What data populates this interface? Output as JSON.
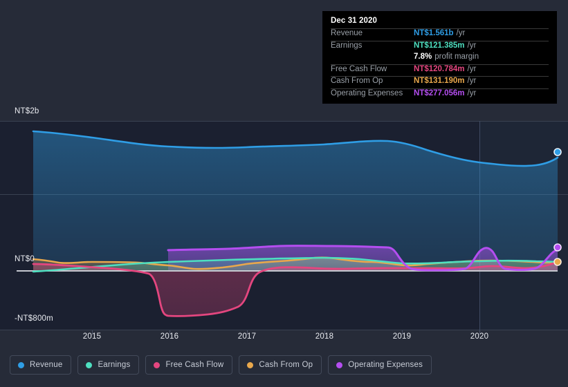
{
  "tooltip": {
    "date": "Dec 31 2020",
    "rows": [
      {
        "label": "Revenue",
        "value": "NT$1.561b",
        "unit": "/yr",
        "color": "#2f9ee6"
      },
      {
        "label": "Earnings",
        "value": "NT$121.385m",
        "unit": "/yr",
        "color": "#4edfc0"
      },
      {
        "label": "Free Cash Flow",
        "value": "NT$120.784m",
        "unit": "/yr",
        "color": "#e4467f"
      },
      {
        "label": "Cash From Op",
        "value": "NT$131.190m",
        "unit": "/yr",
        "color": "#e9a84c"
      },
      {
        "label": "Operating Expenses",
        "value": "NT$277.056m",
        "unit": "/yr",
        "color": "#b44ef0"
      }
    ],
    "margin_value": "7.8%",
    "margin_label": "profit margin"
  },
  "legend": [
    {
      "label": "Revenue",
      "color": "#2f9ee6"
    },
    {
      "label": "Earnings",
      "color": "#4edfc0"
    },
    {
      "label": "Free Cash Flow",
      "color": "#e4467f"
    },
    {
      "label": "Cash From Op",
      "color": "#e9a84c"
    },
    {
      "label": "Operating Expenses",
      "color": "#b44ef0"
    }
  ],
  "axis": {
    "y_top_label": "NT$2b",
    "y_zero_label": "NT$0",
    "y_bottom_label": "-NT$800m",
    "x_labels": [
      "2015",
      "2016",
      "2017",
      "2018",
      "2019",
      "2020"
    ]
  },
  "chart_data": {
    "type": "area",
    "title": "",
    "xlabel": "",
    "ylabel": "",
    "currency": "NT$",
    "ylim": [
      -800,
      2000
    ],
    "yunit": "millions",
    "yticks": [
      2000,
      0,
      -800
    ],
    "ytick_labels": [
      "NT$2b",
      "NT$0",
      "-NT$800m"
    ],
    "xlim": [
      "2014.5",
      "2020.9"
    ],
    "xticks": [
      "2015",
      "2016",
      "2017",
      "2018",
      "2019",
      "2020"
    ],
    "grid": true,
    "legend_position": "bottom",
    "forecast_band_start": "2020",
    "x": [
      2014.55,
      2014.8,
      2015.0,
      2015.25,
      2015.5,
      2015.75,
      2016.0,
      2016.25,
      2016.5,
      2016.75,
      2017.0,
      2017.25,
      2017.5,
      2017.75,
      2018.0,
      2018.25,
      2018.5,
      2018.75,
      2019.0,
      2019.25,
      2019.5,
      2019.75,
      2020.0,
      2020.25,
      2020.5,
      2020.75,
      2020.9
    ],
    "series": [
      {
        "name": "Revenue",
        "color": "#2f9ee6",
        "values": [
          1880,
          1862,
          1845,
          1820,
          1800,
          1790,
          1785,
          1780,
          1775,
          1778,
          1782,
          1775,
          1770,
          1778,
          1790,
          1800,
          1790,
          1760,
          1700,
          1660,
          1640,
          1620,
          1600,
          1570,
          1548,
          1550,
          1561
        ]
      },
      {
        "name": "Earnings",
        "color": "#4edfc0",
        "values": [
          -10,
          0,
          10,
          25,
          40,
          55,
          68,
          78,
          85,
          92,
          96,
          100,
          104,
          108,
          112,
          115,
          116,
          112,
          104,
          100,
          104,
          110,
          114,
          116,
          118,
          120,
          121
        ]
      },
      {
        "name": "Free Cash Flow",
        "color": "#e4467f",
        "values": [
          95,
          92,
          88,
          80,
          72,
          60,
          20,
          -480,
          -660,
          -670,
          -660,
          -640,
          -600,
          -540,
          -430,
          -220,
          -30,
          40,
          60,
          55,
          40,
          50,
          80,
          95,
          45,
          95,
          121
        ]
      },
      {
        "name": "Cash From Op",
        "color": "#e9a84c",
        "values": [
          160,
          150,
          134,
          120,
          118,
          126,
          128,
          120,
          96,
          80,
          76,
          82,
          96,
          110,
          122,
          160,
          185,
          176,
          140,
          118,
          110,
          118,
          130,
          140,
          142,
          138,
          131
        ]
      },
      {
        "name": "Operating Expenses",
        "color": "#b44ef0",
        "values": [
          null,
          null,
          null,
          null,
          null,
          null,
          280,
          282,
          280,
          284,
          292,
          296,
          290,
          288,
          292,
          294,
          290,
          288,
          30,
          22,
          18,
          20,
          160,
          22,
          18,
          120,
          277
        ]
      }
    ]
  }
}
